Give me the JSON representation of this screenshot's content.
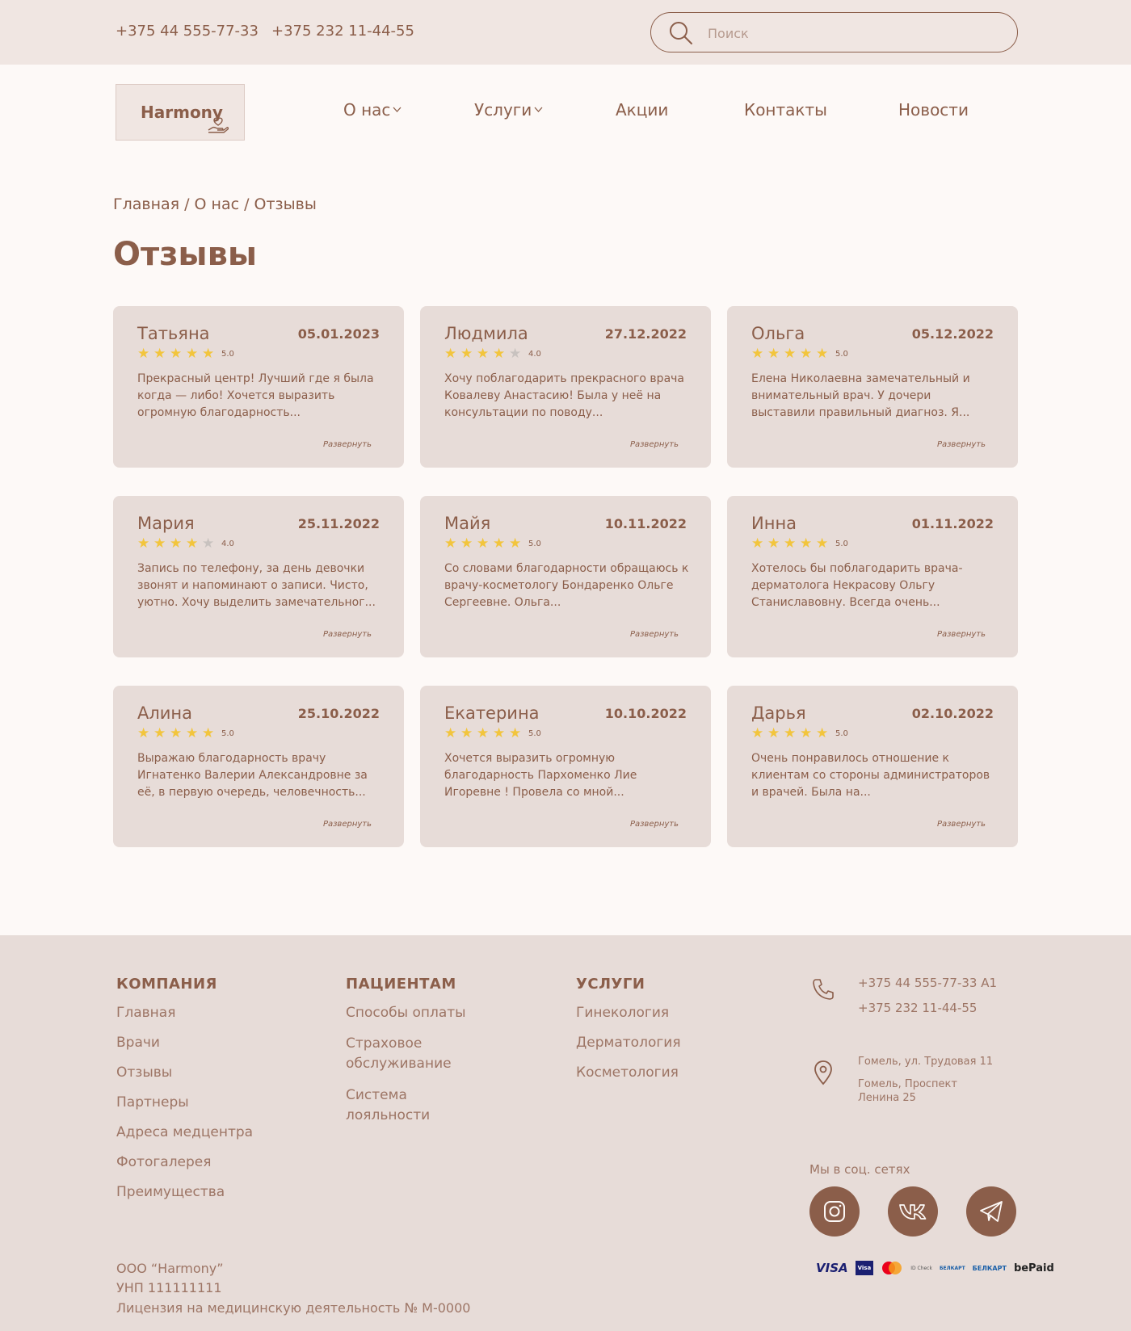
{
  "topbar": {
    "phone1": "+375 44 555-77-33",
    "phone2": "+375 232 11-44-55",
    "search_placeholder": "Поиск"
  },
  "header": {
    "logo": "Harmony",
    "nav": [
      "О нас",
      "Услуги",
      "Акции",
      "Контакты",
      "Новости"
    ]
  },
  "breadcrumb": "Главная / О нас / Отзывы",
  "title": "Отзывы",
  "expand_label": "Развернуть",
  "reviews": [
    {
      "name": "Татьяна",
      "date": "05.01.2023",
      "rating": "5.0",
      "stars": 5,
      "text": "Прекрасный центр! Лучший где я была когда — либо! Хочется выразить огромную благодарность..."
    },
    {
      "name": "Людмила",
      "date": "27.12.2022",
      "rating": "4.0",
      "stars": 4,
      "text": "Хочу поблагодарить прекрасного врача Ковалеву Анастасию! Была у неё на консультации по поводу..."
    },
    {
      "name": "Ольга",
      "date": "05.12.2022",
      "rating": "5.0",
      "stars": 5,
      "text": "Елена Николаевна замечательный и внимательный врач. У дочери выставили правильный диагноз. Я..."
    },
    {
      "name": "Мария",
      "date": "25.11.2022",
      "rating": "4.0",
      "stars": 4,
      "text": "Запись по телефону, за день девочки звонят и напоминают о записи. Чисто, уютно. Хочу выделить замечательног..."
    },
    {
      "name": "Майя",
      "date": "10.11.2022",
      "rating": "5.0",
      "stars": 5,
      "text": "Со словами благодарности обращаюсь к врачу-косметологу Бондаренко Ольге Сергеевне. Ольга..."
    },
    {
      "name": "Инна",
      "date": "01.11.2022",
      "rating": "5.0",
      "stars": 5,
      "text": "Хотелось бы поблагодарить врача-дерматолога Некрасову Ольгу Станиславовну. Всегда очень..."
    },
    {
      "name": "Алина",
      "date": "25.10.2022",
      "rating": "5.0",
      "stars": 5,
      "text": "Выражаю благодарность врачу Игнатенко Валерии Александровне за её, в первую очередь, человечность..."
    },
    {
      "name": "Екатерина",
      "date": "10.10.2022",
      "rating": "5.0",
      "stars": 5,
      "text": "Хочется выразить огромную благодарность  Пархоменко Лие Игоревне ! Провела со мной..."
    },
    {
      "name": "Дарья",
      "date": "02.10.2022",
      "rating": "5.0",
      "stars": 5,
      "text": "Очень понравилось отношение к клиентам со стороны администраторов и врачей. Была на..."
    }
  ],
  "footer": {
    "company": {
      "title": "КОМПАНИЯ",
      "links": [
        "Главная",
        "Врачи",
        "Отзывы",
        "Партнеры",
        "Адреса медцентра",
        "Фотогалерея",
        "Преимущества"
      ]
    },
    "patients": {
      "title": "ПАЦИЕНТАМ",
      "links": [
        "Способы оплаты",
        "Страховое обслуживание",
        "Система лояльности"
      ]
    },
    "services": {
      "title": "УСЛУГИ",
      "links": [
        "Гинекология",
        "Дерматология",
        "Косметология"
      ]
    },
    "phone1": "+375 44 555-77-33 A1",
    "phone2": "+375 232 11-44-55",
    "address1": "Гомель, ул. Трудовая 11",
    "address2": "Гомель, Проспект Ленина 25",
    "social_label": "Мы в соц. сетях",
    "legal": [
      "ООО “Harmony”",
      "УНП 111111111",
      "Лицензия на медицинскую деятельность № М-0000"
    ],
    "payments": [
      "VISA",
      "Visa",
      "Mastercard",
      "ID Check",
      "БЕЛКАРТ",
      "БЕЛКАРТ",
      "bePaid"
    ]
  },
  "colors": {
    "accent": "#8b5e4a",
    "topbar": "#f0e6e2",
    "card": "#e7dcd8",
    "page": "#fdf9f7",
    "star": "#f2c53d",
    "star_off": "#c8c2bf"
  }
}
